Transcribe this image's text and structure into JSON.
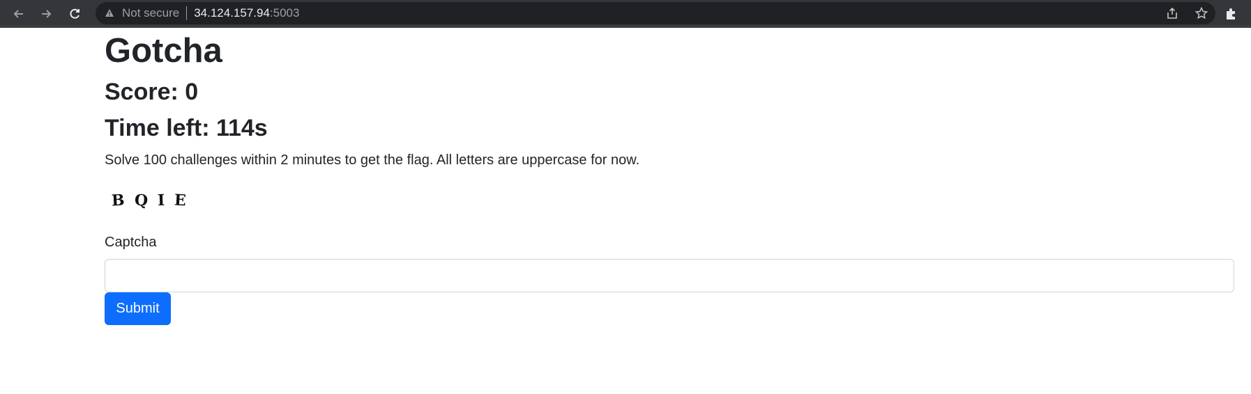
{
  "browser": {
    "security_label": "Not secure",
    "url_host": "34.124.157.94",
    "url_port": ":5003"
  },
  "page": {
    "title": "Gotcha",
    "score": "Score: 0",
    "time_left": "Time left: 114s",
    "instructions": "Solve 100 challenges within 2 minutes to get the flag. All letters are uppercase for now.",
    "captcha_letters": [
      "B",
      "Q",
      "I",
      "E"
    ],
    "field_label": "Captcha",
    "field_value": "",
    "submit_label": "Submit"
  },
  "colors": {
    "primary": "#0d6efd",
    "text": "#212529",
    "chrome_bg": "#35363a",
    "omnibox_bg": "#202124"
  }
}
